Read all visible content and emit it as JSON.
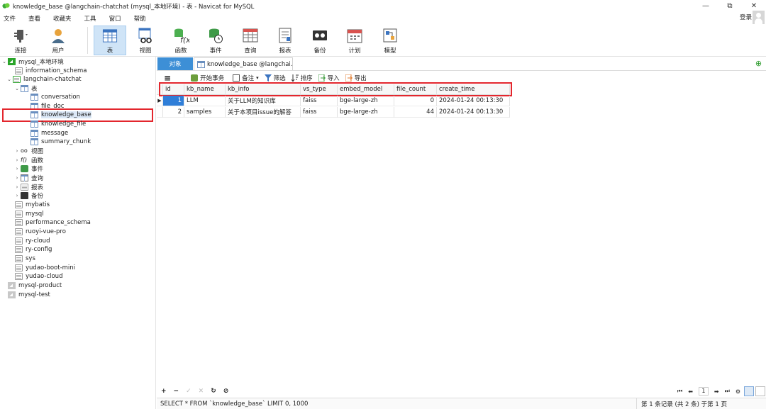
{
  "window": {
    "title": "knowledge_base @langchain-chatchat (mysql_本地环境) - 表 - Navicat for MySQL",
    "controls": [
      "—",
      "⧉",
      "✕"
    ]
  },
  "menu": {
    "items": [
      "文件",
      "查看",
      "收藏夹",
      "工具",
      "窗口",
      "帮助"
    ],
    "login": "登录"
  },
  "toolbar": {
    "buttons": [
      {
        "label": "连接",
        "icon": "plug-icon"
      },
      {
        "label": "用户",
        "icon": "user-icon"
      },
      {
        "label": "表",
        "icon": "table-icon",
        "active": true
      },
      {
        "label": "视图",
        "icon": "view-icon"
      },
      {
        "label": "函数",
        "icon": "function-icon"
      },
      {
        "label": "事件",
        "icon": "event-icon"
      },
      {
        "label": "查询",
        "icon": "query-icon"
      },
      {
        "label": "报表",
        "icon": "report-icon"
      },
      {
        "label": "备份",
        "icon": "backup-icon"
      },
      {
        "label": "计划",
        "icon": "schedule-icon"
      },
      {
        "label": "模型",
        "icon": "model-icon"
      }
    ]
  },
  "tree": {
    "connection": "mysql_本地环境",
    "databases_top": [
      "information_schema",
      "langchain-chatchat"
    ],
    "tables_group": "表",
    "tables": [
      "conversation",
      "file_doc",
      "knowledge_base",
      "knowledge_file",
      "message",
      "summary_chunk"
    ],
    "groups": [
      "视图",
      "函数",
      "事件",
      "查询",
      "报表",
      "备份"
    ],
    "databases_bottom": [
      "mybatis",
      "mysql",
      "performance_schema",
      "ruoyi-vue-pro",
      "ry-cloud",
      "ry-config",
      "sys",
      "yudao-boot-mini",
      "yudao-cloud"
    ],
    "other_connections": [
      "mysql-product",
      "mysql-test"
    ]
  },
  "tabs": {
    "objects": "对象",
    "table_tab": "knowledge_base @langchai..."
  },
  "data_toolbar": {
    "menu_icon": "≡",
    "begin_transaction": "开始事务",
    "notes": "备注",
    "filter": "筛选",
    "sort": "排序",
    "import": "导入",
    "export": "导出"
  },
  "grid": {
    "columns": [
      "id",
      "kb_name",
      "kb_info",
      "vs_type",
      "embed_model",
      "file_count",
      "create_time"
    ],
    "rows": [
      [
        "1",
        "LLM",
        "关于LLM的知识库",
        "faiss",
        "bge-large-zh",
        "0",
        "2024-01-24 00:13:30"
      ],
      [
        "2",
        "samples",
        "关于本项目issue的解答",
        "faiss",
        "bge-large-zh",
        "44",
        "2024-01-24 00:13:30"
      ]
    ]
  },
  "bottom": {
    "tools": [
      "+",
      "−",
      "✓",
      "✕",
      "↻",
      "⊘"
    ],
    "page": "1"
  },
  "status": {
    "sql": "SELECT * FROM `knowledge_base` LIMIT 0, 1000",
    "records": "第 1 条记录 (共 2 条) 于第 1 页"
  }
}
